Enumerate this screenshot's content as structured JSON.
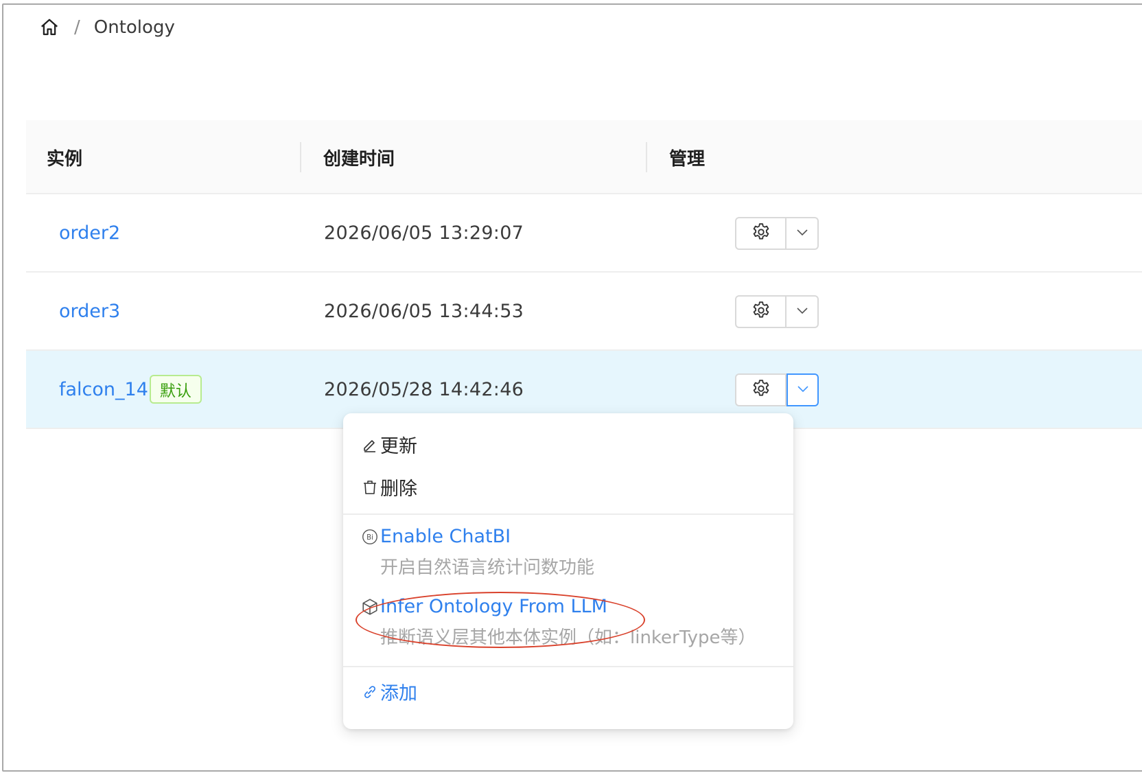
{
  "breadcrumb": {
    "home_icon": "home-icon",
    "separator": "/",
    "current": "Ontology"
  },
  "table": {
    "columns": [
      "实例",
      "创建时间",
      "管理"
    ],
    "rows": [
      {
        "name": "order2",
        "created": "2026/06/05 13:29:07",
        "default_tag": ""
      },
      {
        "name": "order3",
        "created": "2026/06/05 13:44:53",
        "default_tag": ""
      },
      {
        "name": "falcon_14",
        "created": "2026/05/28 14:42:46",
        "default_tag": "默认"
      }
    ],
    "row_actions": {
      "settings_icon": "gear-icon",
      "menu_icon": "chevron-down-icon"
    }
  },
  "dropdown": {
    "update": "更新",
    "delete": "删除",
    "enable_chatbi": {
      "title": "Enable ChatBI",
      "desc": "开启自然语言统计问数功能"
    },
    "infer_ontology": {
      "title": "Infer Ontology From LLM",
      "desc": "推断语义层其他本体实例（如：linkerType等）"
    },
    "add": "添加"
  },
  "colors": {
    "link": "#2f80ed",
    "selected_row": "#e6f6fd",
    "tag_green": "#389e0d",
    "annotation_red": "#d9412b"
  }
}
